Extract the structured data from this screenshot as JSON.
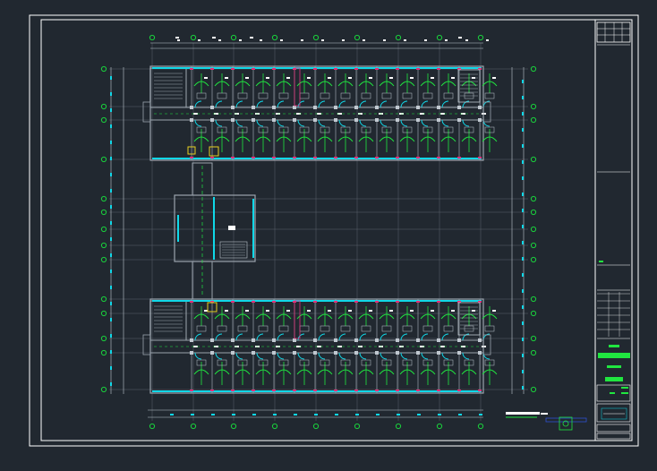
{
  "drawing": {
    "kind": "CAD floor plan (electrical layout)",
    "theme": {
      "background": "#212830",
      "frame": "#ffffff",
      "wall": "#9aa3ad",
      "axis_marker": "#19d23c",
      "circuit": "#20e640",
      "glazing": "#10d8e8",
      "stair": "#c0c8d0",
      "red_detail": "#e0307a",
      "label": "#ffffff"
    },
    "grid_top_labels": [
      "",
      "",
      "",
      "",
      "",
      "",
      "",
      "",
      "",
      "",
      "",
      "",
      "",
      ""
    ],
    "grid_side_labels": [
      "",
      "",
      "",
      "",
      "",
      "",
      "",
      "",
      "",
      "",
      "",
      "",
      "",
      "",
      "",
      "",
      "",
      ""
    ],
    "title_block": {
      "status_bar_color": "#20e640",
      "rows": 6
    }
  }
}
